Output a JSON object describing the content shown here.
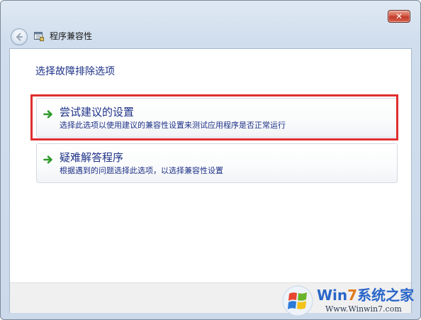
{
  "window": {
    "title": "程序兼容性",
    "close_symbol": "✕"
  },
  "main": {
    "heading": "选择故障排除选项",
    "options": [
      {
        "title": "尝试建议的设置",
        "description": "选择此选项以使用建议的兼容性设置来测试应用程序是否正常运行",
        "highlighted": true
      },
      {
        "title": "疑难解答程序",
        "description": "根据遇到的问题选择此选项，以选择兼容性设置",
        "highlighted": false
      }
    ]
  },
  "watermark": {
    "brand_prefix": "Win",
    "brand_seven": "7",
    "brand_suffix": "系统之家",
    "url": "Www.Winwin7.com"
  },
  "colors": {
    "link_blue": "#1e3287",
    "highlight_red": "#e02e2e",
    "arrow_green": "#2e9a2a"
  },
  "icons": {
    "back": "back-arrow-icon",
    "title": "program-compatibility-icon",
    "option_arrow": "green-arrow-icon",
    "close": "close-icon"
  }
}
